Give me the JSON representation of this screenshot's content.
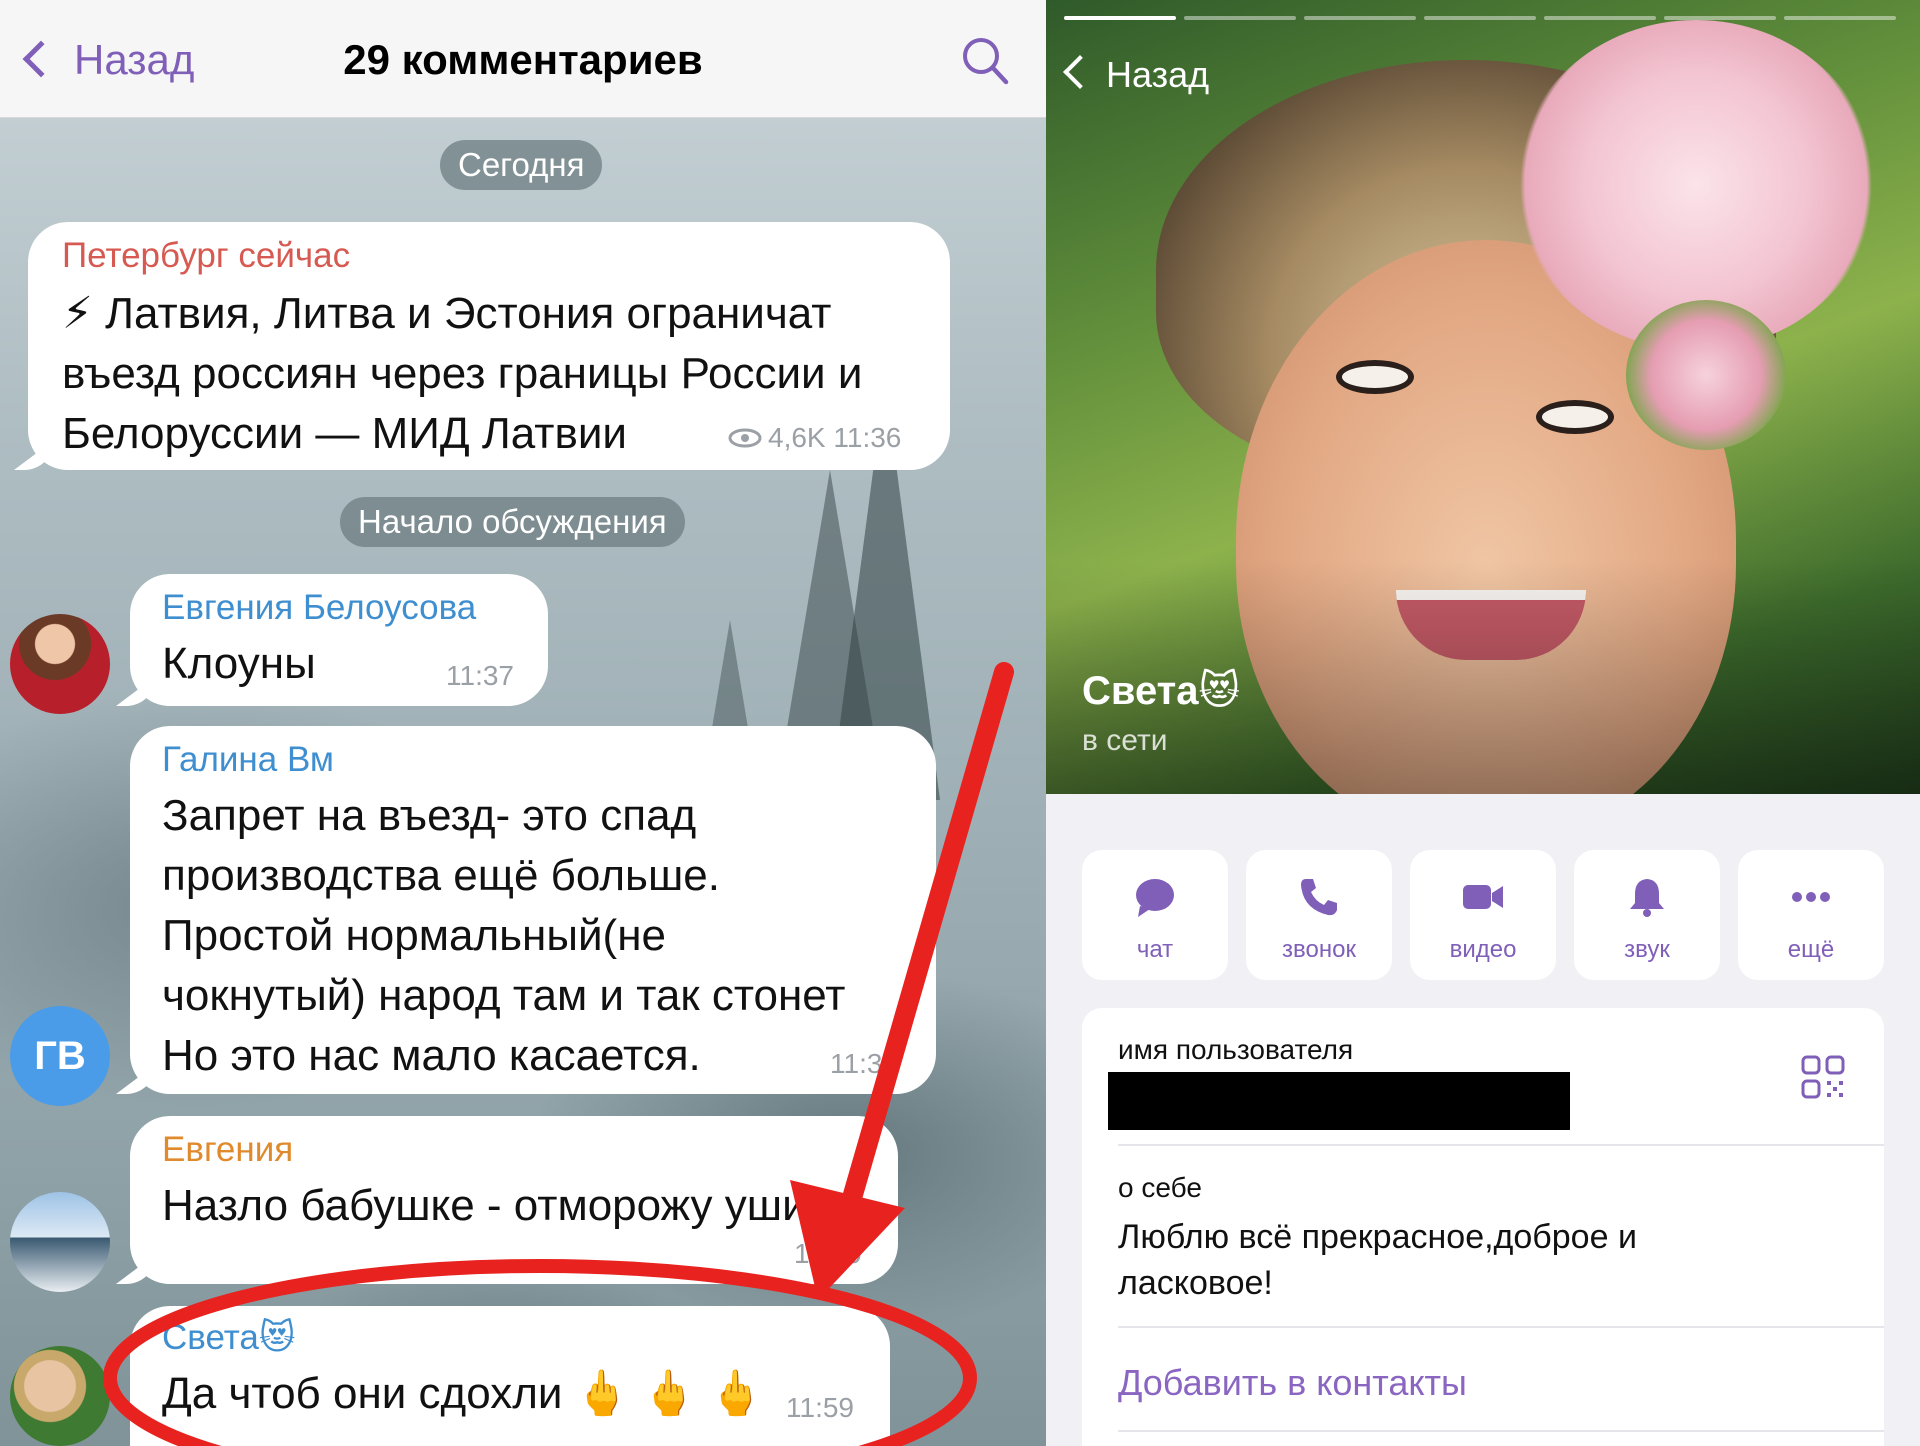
{
  "chat": {
    "back_label": "Назад",
    "title": "29 комментариев",
    "date_pill": "Сегодня",
    "discussion_pill": "Начало обсуждения",
    "post": {
      "sender": "Петербург сейчас",
      "text": "⚡ Латвия, Литва и Эстония ограничат въезд россиян через границы России и Белоруссии —  МИД Латвии",
      "views": "4,6K 11:36"
    },
    "messages": [
      {
        "sender": "Евгения Белоусова",
        "text": "Клоуны",
        "time": "11:37"
      },
      {
        "sender": "Галина Вм",
        "avatar_initials": "ГВ",
        "text": "Запрет на въезд- это спад\nпроизводства ещё больше.\nПростой нормальный(не\nчокнутый) народ там и так стонет\nНо это нас мало касается.",
        "time": "11:39"
      },
      {
        "sender": "Евгения",
        "text": "Назло бабушке - отморожу уши",
        "time": "11:49"
      },
      {
        "sender": "Света😻",
        "text": "Да чтоб они сдохли 🖕 🖕 🖕",
        "time": "11:59"
      }
    ],
    "colors": {
      "accent": "#7f5fb8",
      "post_sender": "#d65a52",
      "blue_sender": "#3f8fd0",
      "orange_sender": "#e08a2e",
      "annotation": "#e8231f"
    }
  },
  "profile": {
    "back_label": "Назад",
    "name": "Света😻",
    "status": "в сети",
    "actions": [
      {
        "label": "чат",
        "icon": "chat-icon"
      },
      {
        "label": "звонок",
        "icon": "phone-icon"
      },
      {
        "label": "видео",
        "icon": "video-icon"
      },
      {
        "label": "звук",
        "icon": "bell-icon"
      },
      {
        "label": "ещё",
        "icon": "more-icon"
      }
    ],
    "username_label": "имя пользователя",
    "about_label": "о себе",
    "about_text": "Люблю всё прекрасное,доброе и ласковое!",
    "add_contact": "Добавить в контакты"
  }
}
